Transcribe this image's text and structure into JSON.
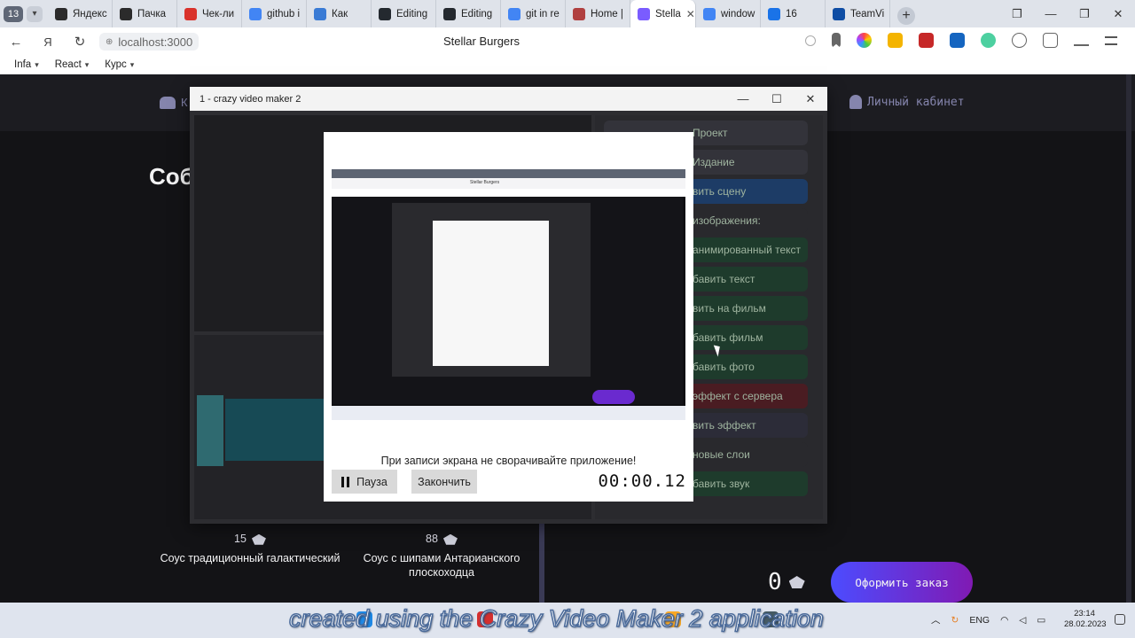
{
  "browser": {
    "tab_count": "13",
    "tabs": [
      {
        "label": "Яндекс",
        "icon": "yandex-icon",
        "color": "#2b2b2b"
      },
      {
        "label": "Пачка",
        "icon": "pachka-icon",
        "color": "#2b2b2b"
      },
      {
        "label": "Чек-ли",
        "icon": "checklist-icon",
        "color": "#d9322b"
      },
      {
        "label": "github i",
        "icon": "google-icon",
        "color": "#4285f4"
      },
      {
        "label": "Как",
        "icon": "cloud-icon",
        "color": "#3a7bd5"
      },
      {
        "label": "Editing",
        "icon": "github-icon",
        "color": "#24292f"
      },
      {
        "label": "Editing",
        "icon": "github-icon",
        "color": "#24292f"
      },
      {
        "label": "git in re",
        "icon": "google-icon",
        "color": "#4285f4"
      },
      {
        "label": "Home |",
        "icon": "home-icon",
        "color": "#b04040"
      },
      {
        "label": "Stella",
        "icon": "stellar-icon",
        "color": "#7a5cff",
        "active": true
      },
      {
        "label": "window",
        "icon": "google-icon",
        "color": "#4285f4"
      },
      {
        "label": "16",
        "icon": "dropbox-icon",
        "color": "#1a73e8"
      },
      {
        "label": "TeamVi",
        "icon": "teamviewer-icon",
        "color": "#0e4da4"
      }
    ],
    "url": "localhost:3000",
    "page_title": "Stellar Burgers",
    "bookmarks": [
      "Infa",
      "React",
      "Курс"
    ]
  },
  "site": {
    "logo_text": "К",
    "cabinet_label": "Личный кабинет",
    "section_title": "Соб",
    "ingredients": [
      {
        "price": "15",
        "name": "Соус традиционный галактический"
      },
      {
        "price": "88",
        "name": "Соус с шипами Антарианского плоскоходца"
      }
    ],
    "total": "0",
    "order_button": "Оформить заказ"
  },
  "cvm": {
    "window_title": "1 - crazy video maker 2",
    "right_panel_items": [
      "Проект",
      "Издание",
      "вить сцену",
      "изображения:",
      "анимированный текст",
      "бавить текст",
      "вить на фильм",
      "бавить фильм",
      "бавить фото",
      "эффект с сервера",
      "вить эффект",
      "новые слои",
      "бавить звук"
    ]
  },
  "recorder": {
    "message": "При записи экрана не сворачивайте приложение!",
    "pause_label": "Пауза",
    "finish_label": "Закончить",
    "timer": "00:00.12"
  },
  "taskbar": {
    "language": "ENG",
    "time": "23:14",
    "date": "28.02.2023"
  },
  "watermark": "created using the Crazy Video Maker 2 application"
}
